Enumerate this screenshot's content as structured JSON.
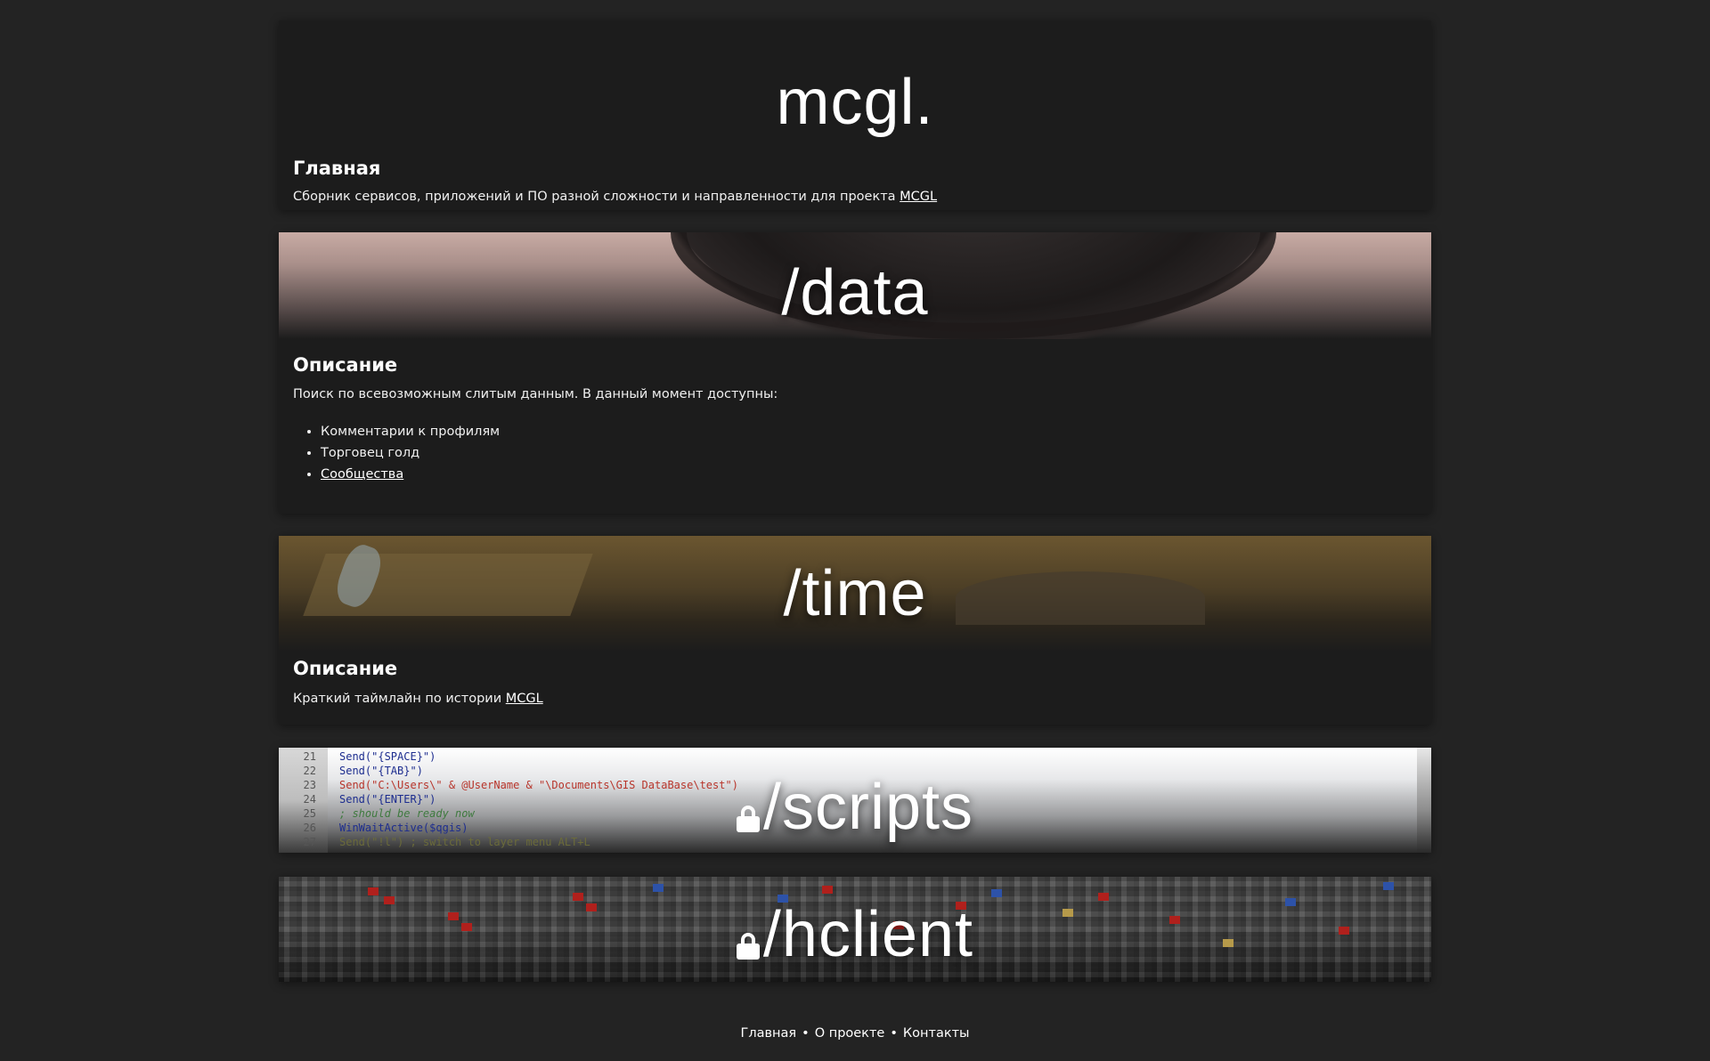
{
  "home": {
    "title": "mcgl.",
    "heading": "Главная",
    "description": "Сборник сервисов, приложений и ПО разной сложности и направленности для проекта",
    "link": "MCGL"
  },
  "data_card": {
    "title": "/data",
    "heading": "Описание",
    "description": "Поиск по всевозможным слитым данным. В данный момент доступны:",
    "items": [
      "Комментарии к профилям",
      "Торговец голд",
      "Сообщества"
    ]
  },
  "time_card": {
    "title": "/time",
    "heading": "Описание",
    "description": "Краткий таймлайн по истории",
    "link": "MCGL"
  },
  "scripts_card": {
    "title": "/scripts",
    "locked": true,
    "code_lines": [
      {
        "n": "21",
        "text": "Send(\"{SPACE}\")"
      },
      {
        "n": "22",
        "text": "Send(\"{TAB}\")"
      },
      {
        "n": "23",
        "text": "Send(\"C:\\Users\\\" & @UserName & \"\\Documents\\GIS DataBase\\test\")"
      },
      {
        "n": "24",
        "text": "Send(\"{ENTER}\")"
      },
      {
        "n": "25",
        "text": "; should be ready now"
      },
      {
        "n": "26",
        "text": "WinWaitActive($qgis)"
      },
      {
        "n": "27",
        "text": "Send(\"!l\") ; switch to layer menu ALT+L"
      }
    ]
  },
  "hclient_card": {
    "title": "/hclient",
    "locked": true
  },
  "footer": {
    "links": [
      "Главная",
      "О проекте",
      "Контакты"
    ],
    "separator": "•"
  }
}
